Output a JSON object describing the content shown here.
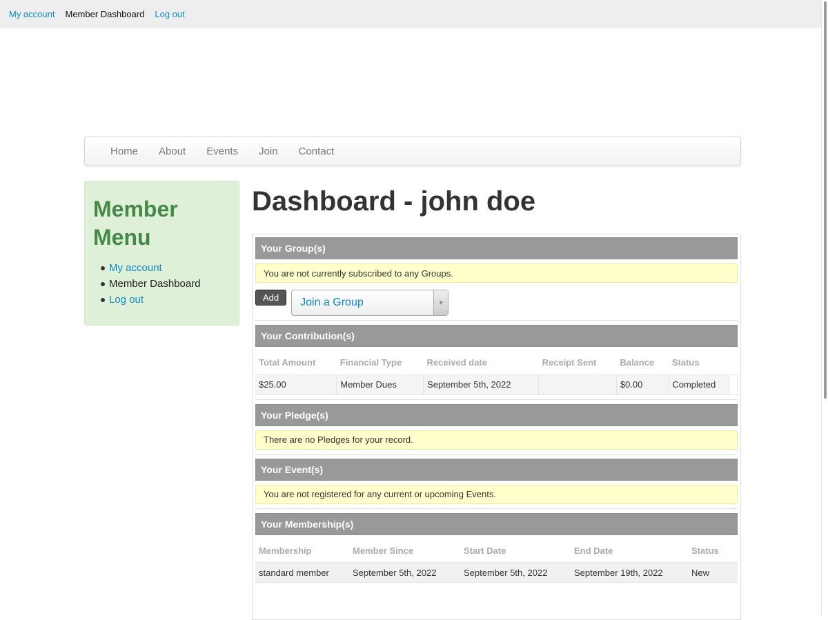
{
  "topbar": {
    "items": [
      "My account",
      "Member Dashboard",
      "Log out"
    ]
  },
  "nav": {
    "items": [
      "Home",
      "About",
      "Events",
      "Join",
      "Contact"
    ]
  },
  "sidebar": {
    "title": "Member Menu",
    "items": [
      "My account",
      "Member Dashboard",
      "Log out"
    ]
  },
  "page": {
    "title": "Dashboard - john doe"
  },
  "groups": {
    "header": "Your Group(s)",
    "notice": "You are not currently subscribed to any Groups.",
    "add_label": "Add",
    "select_value": "Join a Group"
  },
  "contributions": {
    "header": "Your Contribution(s)",
    "columns": [
      "Total Amount",
      "Financial Type",
      "Received date",
      "Receipt Sent",
      "Balance",
      "Status"
    ],
    "rows": [
      [
        "$25.00",
        "Member Dues",
        "September 5th, 2022",
        "",
        "$0.00",
        "Completed"
      ]
    ]
  },
  "pledges": {
    "header": "Your Pledge(s)",
    "notice": "There are no Pledges for your record."
  },
  "events": {
    "header": "Your Event(s)",
    "notice": "You are not registered for any current or upcoming Events."
  },
  "memberships": {
    "header": "Your Membership(s)",
    "columns": [
      "Membership",
      "Member Since",
      "Start Date",
      "End Date",
      "Status"
    ],
    "rows": [
      [
        "standard member",
        "September 5th, 2022",
        "September 5th, 2022",
        "September 19th, 2022",
        "New"
      ]
    ]
  }
}
